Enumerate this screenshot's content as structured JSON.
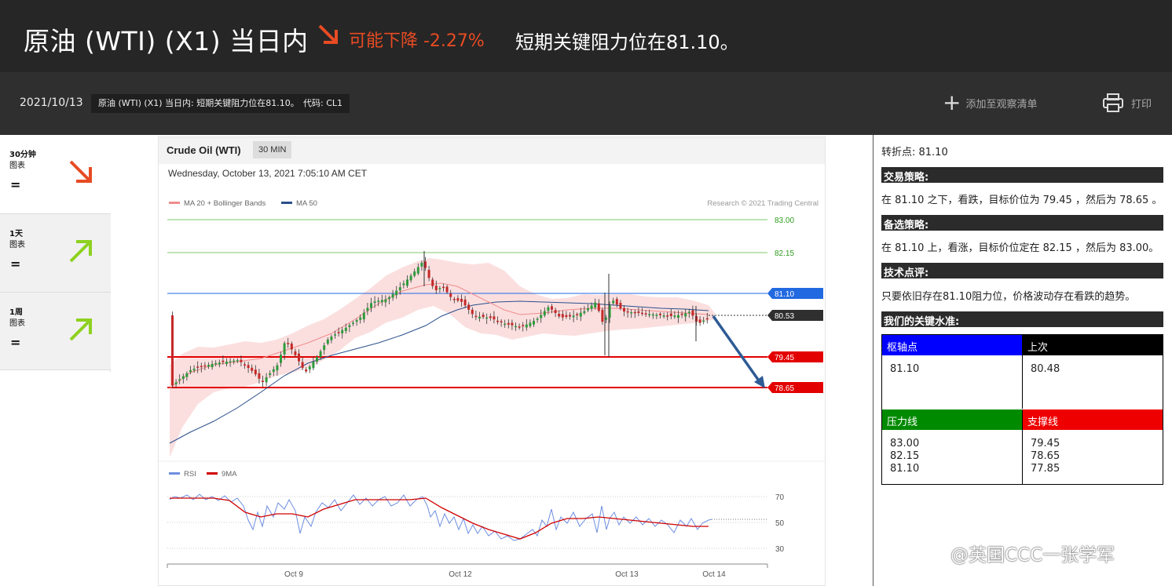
{
  "header": {
    "title": "原油 (WTI) (X1) 当日内",
    "direction_text": "可能下降 -2.27%",
    "headline": "短期关键阻力位在81.10。",
    "accent_color": "#e84b23"
  },
  "subbar": {
    "date": "2021/10/13",
    "description_chip": "原油 (WTI) (X1) 当日内: 短期关键阻力位在81.10。",
    "code_chip": "代码: CL1",
    "watchlist_label": "添加至观察清单",
    "print_label": "打印"
  },
  "timeframes": [
    {
      "title": "30分钟",
      "sub": "图表",
      "trend": "=",
      "arrow": "arrow-down-right-icon",
      "color": "#e84b23"
    },
    {
      "title": "1天",
      "sub": "图表",
      "trend": "=",
      "arrow": "arrow-up-right-icon",
      "color": "#8ed11f"
    },
    {
      "title": "1周",
      "sub": "图表",
      "trend": "=",
      "arrow": "arrow-up-right-icon",
      "color": "#8ed11f"
    }
  ],
  "chart": {
    "instrument": "Crude Oil (WTI)",
    "timeframe": "30 MIN",
    "datetime": "Wednesday, October 13, 2021 7:05:10 AM CET",
    "legend": {
      "ma20": "MA 20 + Bollinger Bands",
      "ma50": "MA 50"
    },
    "copyright": "Research © 2021 Trading Central",
    "rsi_legend": {
      "rsi": "RSI",
      "ma9": "9MA"
    }
  },
  "chart_data": {
    "type": "candlestick",
    "price_levels": [
      {
        "value": "83.00",
        "kind": "resistance",
        "color": "#2f9b1d"
      },
      {
        "value": "82.15",
        "kind": "resistance",
        "color": "#2f9b1d"
      },
      {
        "value": "81.10",
        "kind": "pivot",
        "color": "#2169e0"
      },
      {
        "value": "80.53",
        "kind": "last",
        "color": "#2f2f2f"
      },
      {
        "value": "79.45",
        "kind": "support",
        "color": "#e30000"
      },
      {
        "value": "78.65",
        "kind": "support",
        "color": "#e30000"
      }
    ],
    "x_ticks": [
      "Oct 9",
      "Oct 12",
      "Oct 13",
      "Oct 14"
    ],
    "rsi_ticks": [
      "70",
      "50",
      "30"
    ]
  },
  "right": {
    "pivot_line": "转折点: 81.10",
    "strategy_title": "交易策略:",
    "strategy_text": "在 81.10 之下，看跌，目标价位为 79.45 ，然后为 78.65 。",
    "alt_title": "备选策略:",
    "alt_text": "在 81.10 上，看涨，目标价位定在 82.15 ，然后为 83.00。",
    "comment_title": "技术点评:",
    "comment_text": "只要依旧存在81.10阻力位，价格波动存在看跌的趋势。",
    "levels_title": "我们的关键水准:",
    "pivot_head": "枢轴点",
    "pivot_value": "81.10",
    "last_head": "上次",
    "last_value": "80.48",
    "res_head": "压力线",
    "res_values": [
      "83.00",
      "82.15",
      "81.10"
    ],
    "sup_head": "支撑线",
    "sup_values": [
      "79.45",
      "78.65",
      "77.85"
    ],
    "pivot_color": "#0000ff",
    "last_color": "#000000",
    "res_color": "#008a00",
    "sup_color": "#ee0000"
  },
  "watermark": "@英国CCC一张学军"
}
